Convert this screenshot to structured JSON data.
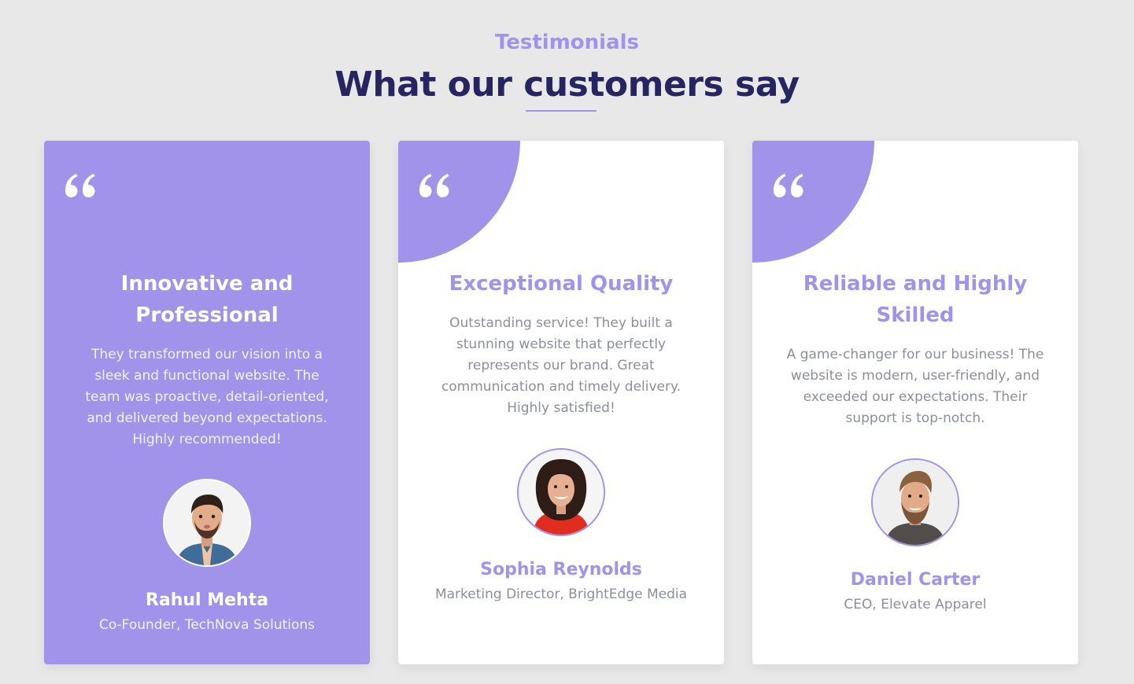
{
  "header": {
    "eyebrow": "Testimonials",
    "headline": "What our customers say"
  },
  "colors": {
    "accent": "#a293ea",
    "heading": "#262562",
    "background": "#e8e8e8",
    "muted_text": "#8c8f99"
  },
  "testimonials": [
    {
      "title": "Innovative and Professional",
      "text": "They transformed our vision into a sleek and functional website. The team was proactive, detail-oriented, and delivered beyond expectations. Highly recommended!",
      "name": "Rahul Mehta",
      "role": "Co-Founder, TechNova Solutions",
      "avatar": "man-thinking-avatar",
      "quote_icon": "quote-icon"
    },
    {
      "title": "Exceptional Quality",
      "text": "Outstanding service! They built a stunning website that perfectly represents our brand. Great communication and timely delivery. Highly satisfied!",
      "name": "Sophia Reynolds",
      "role": "Marketing Director, BrightEdge Media",
      "avatar": "smiling-woman-avatar",
      "quote_icon": "quote-icon"
    },
    {
      "title": "Reliable and Highly Skilled",
      "text": "A game-changer for our business! The website is modern, user-friendly, and exceeded our expectations. Their support is top-notch.",
      "name": "Daniel Carter",
      "role": "CEO, Elevate Apparel",
      "avatar": "bearded-man-avatar",
      "quote_icon": "quote-icon"
    }
  ]
}
